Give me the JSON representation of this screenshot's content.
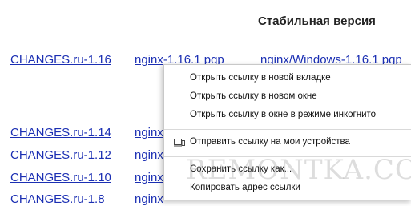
{
  "page": {
    "heading": "Стабильная версия",
    "links": {
      "changes_116": "CHANGES.ru-1.16",
      "nginx_pgp_116": "nginx-1.16.1 pgp",
      "nginx_windows_116": "nginx/Windows-1.16.1 pgp",
      "changes_114": "CHANGES.ru-1.14",
      "nginx_114": "nginx",
      "changes_112": "CHANGES.ru-1.12",
      "nginx_112": "nginx",
      "changes_110": "CHANGES.ru-1.10",
      "nginx_110": "nginx",
      "changes_18": "CHANGES.ru-1.8",
      "nginx_18": "nginx"
    }
  },
  "context_menu": {
    "open_new_tab": "Открыть ссылку в новой вкладке",
    "open_new_window": "Открыть ссылку в новом окне",
    "open_incognito": "Открыть ссылку в окне в режиме инкогнито",
    "send_to_devices": "Отправить ссылку на мои устройства",
    "save_link": "Сохранить ссылку как...",
    "copy_link": "Копировать адрес ссылки"
  },
  "watermark": "REMONTKA.COM"
}
